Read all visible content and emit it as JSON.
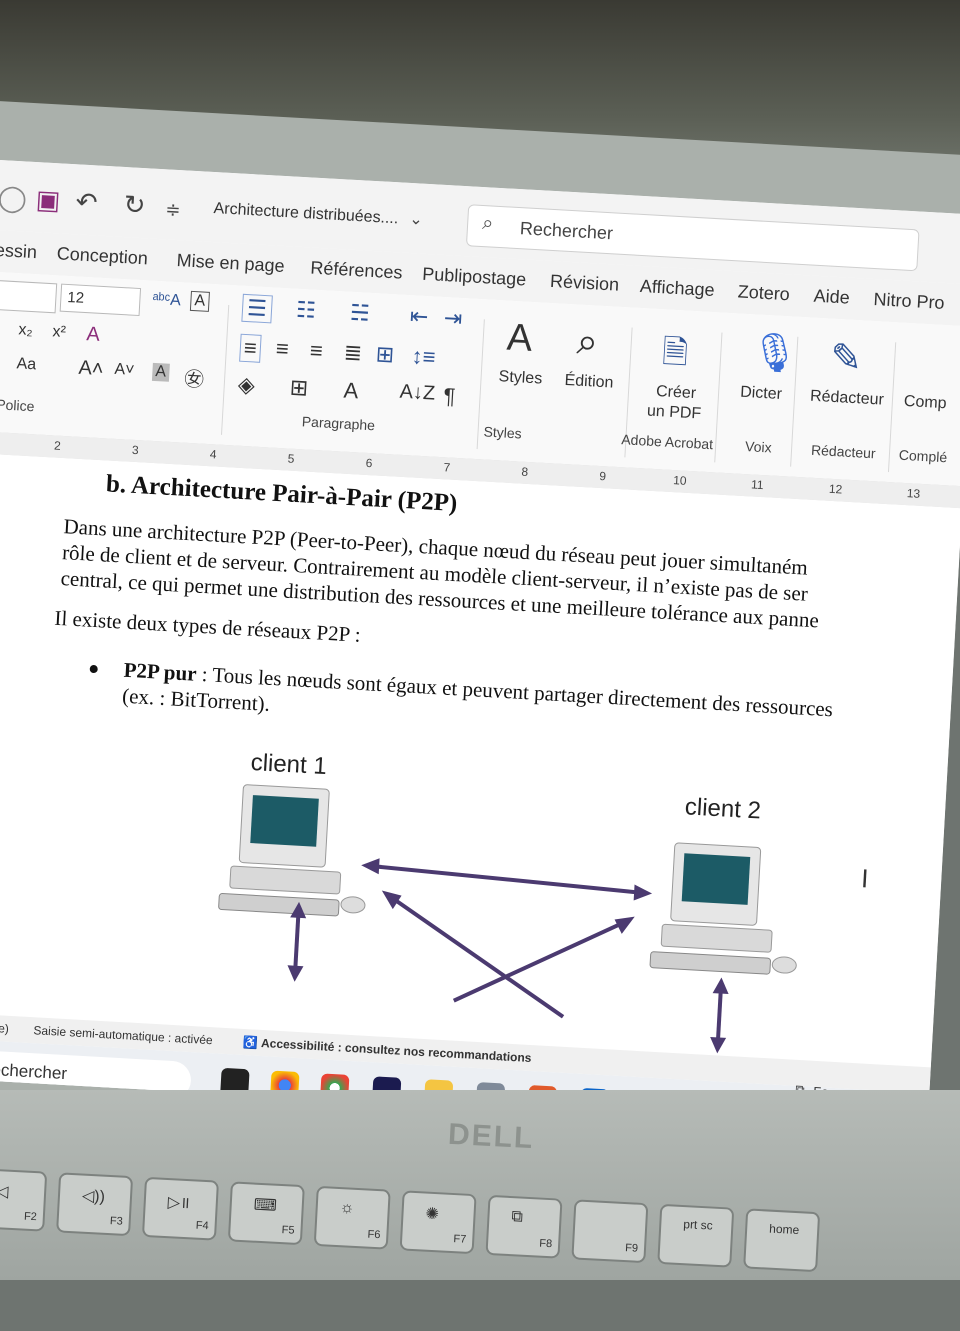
{
  "window": {
    "doc_title": "Architecture distribuées....",
    "search_placeholder": "Rechercher"
  },
  "tabs": [
    "essin",
    "Conception",
    "Mise en page",
    "Références",
    "Publipostage",
    "Révision",
    "Affichage",
    "Zotero",
    "Aide",
    "Nitro Pro"
  ],
  "ribbon": {
    "font_size": "12",
    "groups": {
      "police": "Police",
      "paragraphe": "Paragraphe",
      "styles": "Styles",
      "adobe": "Adobe Acrobat",
      "voix": "Voix",
      "redacteur": "Rédacteur",
      "complements": "Complé"
    },
    "buttons": {
      "styles": "Styles",
      "edition": "Édition",
      "creer_pdf_1": "Créer",
      "creer_pdf_2": "un PDF",
      "dicter": "Dicter",
      "redacteur": "Rédacteur",
      "compl": "Comp"
    },
    "small": {
      "aa": "Aa",
      "sub": "x₂",
      "sup": "x²"
    }
  },
  "ruler": [
    "2",
    "3",
    "4",
    "5",
    "6",
    "7",
    "8",
    "9",
    "10",
    "11",
    "12",
    "13"
  ],
  "document": {
    "heading": "b.  Architecture Pair-à-Pair (P2P)",
    "p1_l1": "Dans une architecture P2P (Peer-to-Peer), chaque nœud du réseau peut jouer simultaném",
    "p1_l2": "rôle de client et de serveur. Contrairement au modèle client-serveur, il n’existe pas de ser",
    "p1_l3": "central, ce qui permet une distribution des ressources et une meilleure tolérance aux panne",
    "p2": "Il existe deux types de réseaux P2P :",
    "bullet_bold": "P2P pur",
    "bullet_rest": " : Tous les nœuds sont égaux et peuvent partager directement des ressources",
    "bullet_l2": "(ex. : BitTorrent).",
    "client1": "client 1",
    "client2": "client 2"
  },
  "status": {
    "lang": "is (France)",
    "autosave": "Saisie semi-automatique : activée",
    "access": "Accessibilité : consultez nos recommandations"
  },
  "taskbar": {
    "search": "Rechercher",
    "focus": "Focus"
  },
  "laptop": {
    "logo": "DELL",
    "keys": [
      "F2",
      "F3",
      "F4",
      "F5",
      "F6",
      "F7",
      "F8",
      "F9",
      "prt sc",
      "home"
    ]
  },
  "colors": {
    "save_icon": "#8b2d7a",
    "dictate": "#3a6fd8",
    "arrow": "#4b3a70",
    "taskbar_word": "#2b5ec9"
  }
}
